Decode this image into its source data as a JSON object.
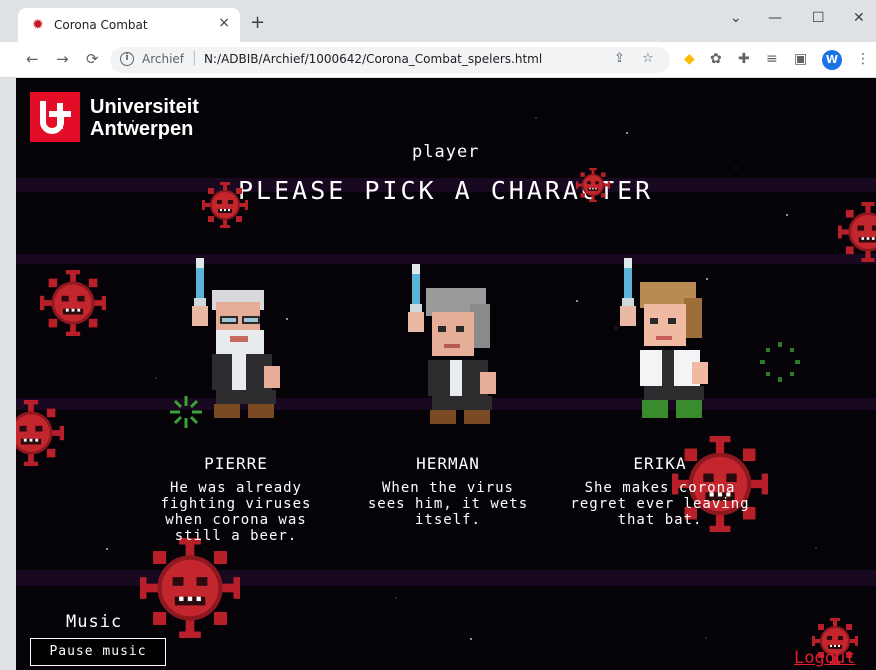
{
  "browser": {
    "tab_title": "Corona Combat",
    "tab_close_glyph": "×",
    "new_tab_glyph": "+",
    "window_controls": {
      "dropdown": "⌄",
      "minimize": "—",
      "maximize": "☐",
      "close": "✕"
    },
    "nav": {
      "back": "←",
      "forward": "→",
      "reload": "⟳"
    },
    "address": {
      "archief_label": "Archief",
      "separator": "|",
      "url": "N:/ADBIB/Archief/1000642/Corona_Combat_spelers.html"
    },
    "profile_initial": "W",
    "icons": [
      "favicon-virus-icon",
      "info-icon",
      "share-icon",
      "star-icon",
      "extension-icons",
      "reading-list-icon",
      "side-panel-icon",
      "menu-icon"
    ]
  },
  "game": {
    "logo": {
      "line1": "Universiteit",
      "line2": "Antwerpen",
      "brand_color": "#e30d28"
    },
    "player_label": "player",
    "headline": "PLEASE PICK A CHARACTER",
    "characters": [
      {
        "name": "PIERRE",
        "description": "He was already\nfighting viruses\nwhen corona was\nstill a beer."
      },
      {
        "name": "HERMAN",
        "description": "When the virus\nsees him, it wets\nitself."
      },
      {
        "name": "ERIKA",
        "description": "She makes corona\nregret ever leaving\nthat bat."
      }
    ],
    "music_label": "Music",
    "pause_button": "Pause music",
    "logout_label": "Logout",
    "colors": {
      "background": "#050307",
      "virus": "#c4262e",
      "logout": "#e31d2c"
    }
  }
}
